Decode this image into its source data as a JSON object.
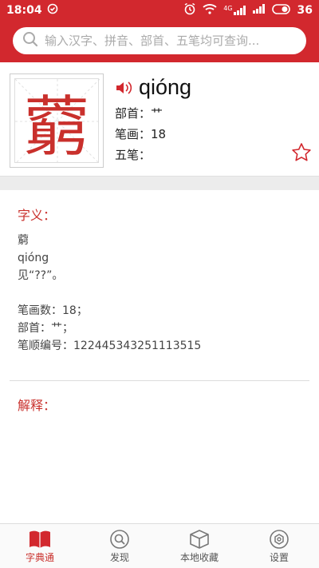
{
  "status_bar": {
    "time": "18:04",
    "network_label": "4G",
    "battery": "36"
  },
  "search": {
    "placeholder": "输入汉字、拼音、部首、五笔均可查询..."
  },
  "character": {
    "glyph": "藭",
    "pinyin": "qióng",
    "radical_line": "部首：艹",
    "strokes_line": "笔画：18",
    "wubi_line": "五笔："
  },
  "meaning": {
    "title": "字义：",
    "lines": [
      "藭",
      "qióng",
      "见“??”。",
      "",
      "笔画数：18；",
      "部首：艹；",
      "笔顺编号：122445343251113515"
    ]
  },
  "explanation": {
    "title": "解释："
  },
  "tabs": [
    {
      "label": "字典通",
      "icon": "book-icon",
      "active": true
    },
    {
      "label": "发现",
      "icon": "discover-icon",
      "active": false
    },
    {
      "label": "本地收藏",
      "icon": "box-icon",
      "active": false
    },
    {
      "label": "设置",
      "icon": "settings-icon",
      "active": false
    }
  ],
  "colors": {
    "brand": "#d2282e",
    "accent_text": "#c9302c"
  }
}
